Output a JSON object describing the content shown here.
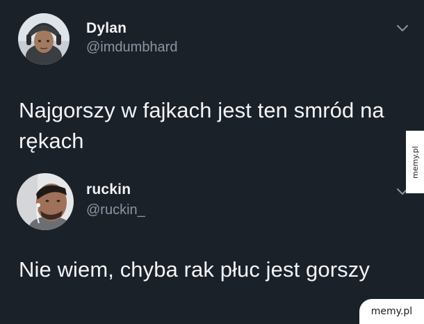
{
  "tweets": [
    {
      "display_name": "Dylan",
      "handle": "@imdumbhard",
      "text": "Najgorszy w fajkach jest ten smród na rękach"
    },
    {
      "display_name": "ruckin",
      "handle": "@ruckin_",
      "text": "Nie wiem, chyba rak płuc jest gorszy"
    }
  ],
  "watermarks": {
    "side": "memy.pl",
    "corner": "memy.pl"
  },
  "colors": {
    "background": "#1b2129",
    "text": "#f4f5f7",
    "handle": "#8a96a3"
  }
}
